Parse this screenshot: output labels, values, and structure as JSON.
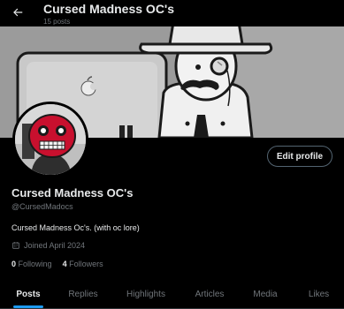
{
  "header": {
    "title": "Cursed Madness OC's",
    "post_count": "15 posts"
  },
  "profile": {
    "display_name": "Cursed Madness OC's",
    "handle": "@CursedMadocs",
    "bio": "Cursed Madness Oc's. (with oc lore)",
    "joined": "Joined April 2024",
    "following_count": "0",
    "following_label": "Following",
    "followers_count": "4",
    "followers_label": "Followers",
    "edit_button": "Edit profile"
  },
  "tabs": [
    {
      "label": "Posts",
      "active": true
    },
    {
      "label": "Replies",
      "active": false
    },
    {
      "label": "Highlights",
      "active": false
    },
    {
      "label": "Articles",
      "active": false
    },
    {
      "label": "Media",
      "active": false
    },
    {
      "label": "Likes",
      "active": false
    }
  ],
  "icons": {
    "back": "arrow-left-icon",
    "calendar": "calendar-icon",
    "apple": "apple-logo-icon"
  },
  "colors": {
    "background": "#000000",
    "text_primary": "#e7e9ea",
    "text_secondary": "#71767b",
    "accent": "#1d9bf0",
    "border": "#536471",
    "avatar_red": "#c8102e"
  }
}
